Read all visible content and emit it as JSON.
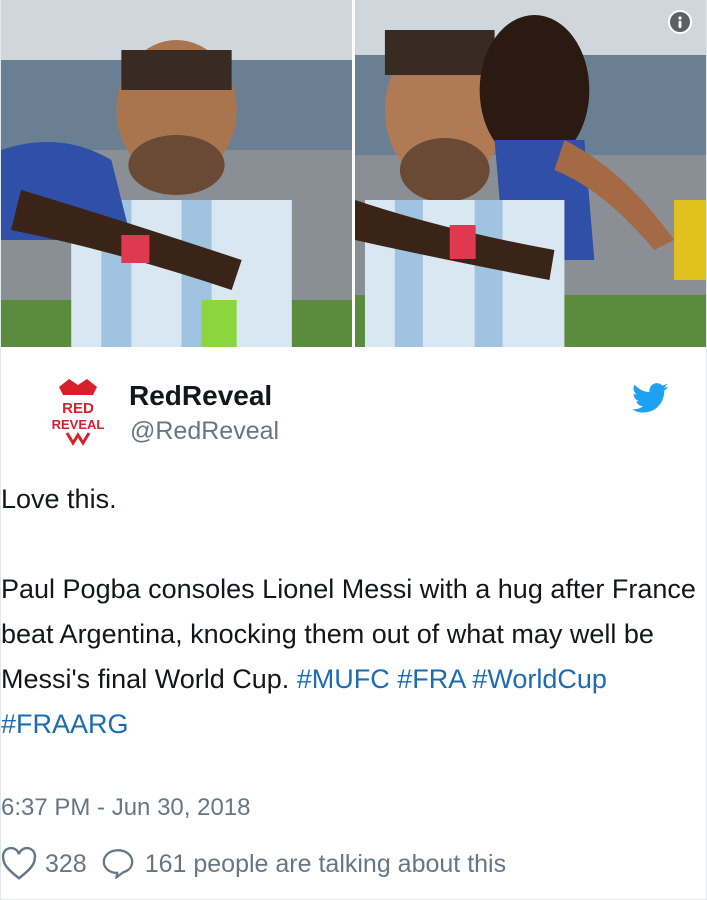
{
  "media": {
    "info_icon": "info-icon"
  },
  "tweet": {
    "display_name": "RedReveal",
    "handle": "@RedReveal",
    "avatar_text_top": "RED",
    "avatar_text_bottom": "REVEAL",
    "brand_icon": "twitter-bird-icon",
    "text_line1": "Love this.",
    "text_body": "Paul Pogba consoles Lionel Messi with a hug after France beat Argentina, knocking them out of what may well be Messi's final World Cup.",
    "hashtags": [
      "#MUFC",
      "#FRA",
      "#WorldCup",
      "#FRAARG"
    ],
    "timestamp": "6:37 PM - Jun 30, 2018",
    "likes": "328",
    "replies_label": "161 people are talking about this"
  },
  "colors": {
    "link": "#1b6bb5",
    "secondary": "#657786",
    "twitter_blue": "#1da1f2",
    "brand_red": "#d6212c"
  }
}
